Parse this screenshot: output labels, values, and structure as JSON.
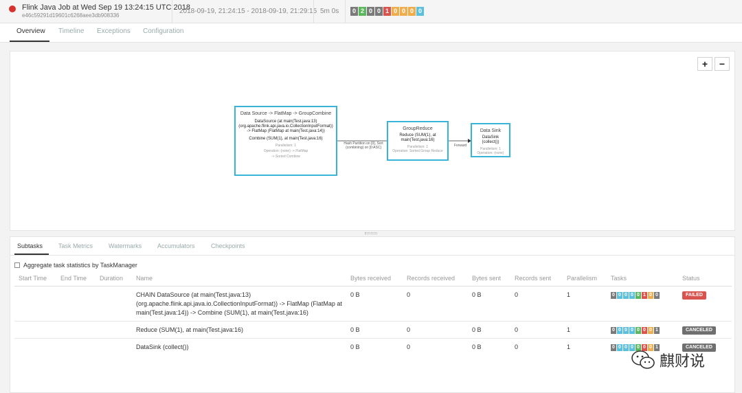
{
  "job": {
    "title": "Flink Java Job at Wed Sep 19 13:24:15 UTC 2018",
    "id": "e46c59291d19601c6268aee3db908336",
    "time_range": "2018-09-19, 21:24:15 - 2018-09-19, 21:29:15",
    "duration": "5m 0s",
    "status_color": "#d9312e",
    "counts": [
      {
        "value": "0",
        "color": "#7a7a7a"
      },
      {
        "value": "2",
        "color": "#5cb85c"
      },
      {
        "value": "0",
        "color": "#7a7a7a"
      },
      {
        "value": "0",
        "color": "#7a7a7a"
      },
      {
        "value": "1",
        "color": "#d9534f"
      },
      {
        "value": "0",
        "color": "#f0ad4e"
      },
      {
        "value": "0",
        "color": "#f0ad4e"
      },
      {
        "value": "0",
        "color": "#f0ad4e"
      },
      {
        "value": "0",
        "color": "#5bc0de"
      }
    ]
  },
  "tabs": [
    "Overview",
    "Timeline",
    "Exceptions",
    "Configuration"
  ],
  "graph": {
    "zoom_in": "+",
    "zoom_out": "−",
    "nodes": [
      {
        "title": "Data Source -> FlatMap -> GroupCombine",
        "desc1": "DataSource (at main(Test.java:13) (org.apache.flink.api.java.io.CollectionInputFormat)) -> FlatMap (FlatMap at main(Test.java:14))",
        "desc2": "Combine (SUM(1), at main(Test.java:16)",
        "parallelism": "Parallelism: 1",
        "operation": "Operation: (none) -> FlatMap",
        "strategy": "-> Sorted Combine"
      },
      {
        "title": "GroupReduce",
        "desc1": "Reduce (SUM(1), at main(Test.java:16)",
        "parallelism": "Parallelism: 1",
        "operation": "Operation: Sorted Group Reduce"
      },
      {
        "title": "Data Sink",
        "desc1": "DataSink (collect())",
        "parallelism": "Parallelism: 1",
        "operation": "Operation: (none)"
      }
    ],
    "edges": [
      {
        "label": "Hash Partition on [0], Sort (combining) on [0:ASC]"
      },
      {
        "label": "Forward"
      }
    ]
  },
  "subtabs": [
    "Subtasks",
    "Task Metrics",
    "Watermarks",
    "Accumulators",
    "Checkpoints"
  ],
  "aggregate_label": "Aggregate task statistics by TaskManager",
  "columns": [
    "Start Time",
    "End Time",
    "Duration",
    "Name",
    "Bytes received",
    "Records received",
    "Bytes sent",
    "Records sent",
    "Parallelism",
    "Tasks",
    "Status"
  ],
  "rows": [
    {
      "name": "CHAIN DataSource (at main(Test.java:13) (org.apache.flink.api.java.io.CollectionInputFormat)) -> FlatMap (FlatMap at main(Test.java:14)) -> Combine (SUM(1), at main(Test.java:16)",
      "bytes_received": "0 B",
      "records_received": "0",
      "bytes_sent": "0 B",
      "records_sent": "0",
      "parallelism": "1",
      "tasks": [
        {
          "value": "0",
          "color": "#7a7a7a"
        },
        {
          "value": "0",
          "color": "#5bc0de"
        },
        {
          "value": "0",
          "color": "#5bc0de"
        },
        {
          "value": "0",
          "color": "#5bc0de"
        },
        {
          "value": "0",
          "color": "#5cb85c"
        },
        {
          "value": "1",
          "color": "#d9534f"
        },
        {
          "value": "0",
          "color": "#f0ad4e"
        },
        {
          "value": "0",
          "color": "#7a7a7a"
        }
      ],
      "status": "FAILED",
      "status_color": "#d9534f"
    },
    {
      "name": "Reduce (SUM(1), at main(Test.java:16)",
      "bytes_received": "0 B",
      "records_received": "0",
      "bytes_sent": "0 B",
      "records_sent": "0",
      "parallelism": "1",
      "tasks": [
        {
          "value": "0",
          "color": "#7a7a7a"
        },
        {
          "value": "0",
          "color": "#5bc0de"
        },
        {
          "value": "0",
          "color": "#5bc0de"
        },
        {
          "value": "0",
          "color": "#5bc0de"
        },
        {
          "value": "0",
          "color": "#5cb85c"
        },
        {
          "value": "0",
          "color": "#d9534f"
        },
        {
          "value": "0",
          "color": "#f0ad4e"
        },
        {
          "value": "1",
          "color": "#7a7a7a"
        }
      ],
      "status": "CANCELED",
      "status_color": "#6f6f6f"
    },
    {
      "name": "DataSink (collect())",
      "bytes_received": "0 B",
      "records_received": "0",
      "bytes_sent": "0 B",
      "records_sent": "0",
      "parallelism": "1",
      "tasks": [
        {
          "value": "0",
          "color": "#7a7a7a"
        },
        {
          "value": "0",
          "color": "#5bc0de"
        },
        {
          "value": "0",
          "color": "#5bc0de"
        },
        {
          "value": "0",
          "color": "#5bc0de"
        },
        {
          "value": "0",
          "color": "#5cb85c"
        },
        {
          "value": "0",
          "color": "#d9534f"
        },
        {
          "value": "0",
          "color": "#f0ad4e"
        },
        {
          "value": "1",
          "color": "#7a7a7a"
        }
      ],
      "status": "CANCELED",
      "status_color": "#6f6f6f"
    }
  ],
  "watermark": {
    "text": "麒财说",
    "icon": "wechat-icon"
  }
}
